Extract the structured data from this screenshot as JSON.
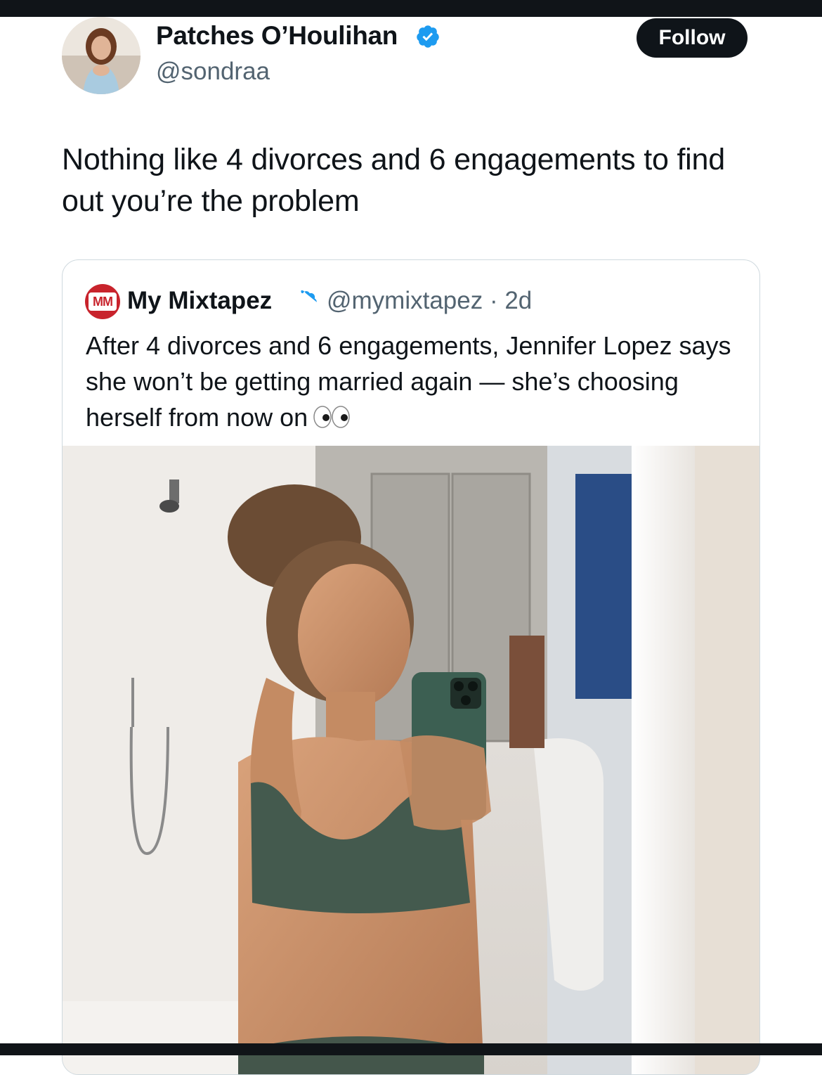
{
  "author": {
    "display_name": "Patches O’Houlihan",
    "handle": "@sondraa",
    "verified": true
  },
  "follow_button": {
    "label": "Follow"
  },
  "tweet": {
    "text": "Nothing like 4 divorces and 6 engagements to find out you’re the problem"
  },
  "quoted_tweet": {
    "avatar_text": "MM",
    "display_name": "My Mixtapez",
    "verified": true,
    "handle_time": "@mymixtapez · 2d",
    "text": "After 4 divorces and 6 engagements, Jennifer Lopez says she won’t be getting married again — she’s choosing herself from now on",
    "emoji": "eyes-emoji",
    "media": "selfie-photo"
  },
  "colors": {
    "follow_bg": "#0f1419",
    "verified": "#1d9bf0",
    "secondary_text": "#536471",
    "border": "#cfd9de",
    "brand_red": "#c8232c"
  },
  "icons": [
    "verified-badge-icon",
    "eyes-emoji"
  ]
}
